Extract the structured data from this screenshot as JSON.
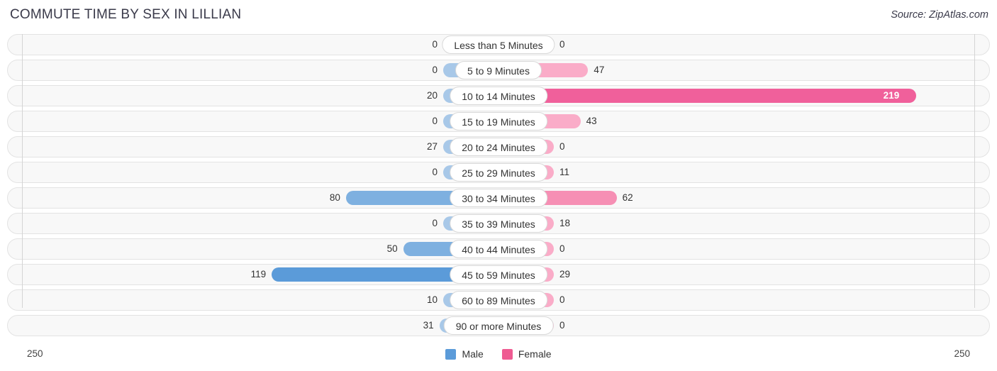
{
  "header": {
    "title": "COMMUTE TIME BY SEX IN LILLIAN",
    "source": "Source: ZipAtlas.com"
  },
  "axis": {
    "left_end": "250",
    "right_end": "250",
    "max": 250
  },
  "legend": {
    "items": [
      {
        "label": "Male",
        "color": "#5b9bd9"
      },
      {
        "label": "Female",
        "color": "#ef5b92"
      }
    ]
  },
  "colors": {
    "male_light": "#a8c8e8",
    "male_mid": "#7eb0e0",
    "male_strong": "#5b9bd9",
    "female_light": "#faacc8",
    "female_mid": "#f68fb4",
    "female_strong": "#f0609b"
  },
  "chart_data": {
    "type": "bar",
    "title": "COMMUTE TIME BY SEX IN LILLIAN",
    "orientation": "horizontal-diverging",
    "xlabel": "",
    "ylabel": "",
    "xlim": [
      250,
      250
    ],
    "grid": false,
    "legend_position": "bottom-center",
    "categories": [
      "Less than 5 Minutes",
      "5 to 9 Minutes",
      "10 to 14 Minutes",
      "15 to 19 Minutes",
      "20 to 24 Minutes",
      "25 to 29 Minutes",
      "30 to 34 Minutes",
      "35 to 39 Minutes",
      "40 to 44 Minutes",
      "45 to 59 Minutes",
      "60 to 89 Minutes",
      "90 or more Minutes"
    ],
    "series": [
      {
        "name": "Male",
        "values": [
          0,
          0,
          20,
          0,
          27,
          0,
          80,
          0,
          50,
          119,
          10,
          31
        ]
      },
      {
        "name": "Female",
        "values": [
          0,
          47,
          219,
          43,
          0,
          11,
          62,
          18,
          0,
          29,
          0,
          0
        ]
      }
    ]
  },
  "rows": [
    {
      "label": "Less than 5 Minutes",
      "male": "0",
      "female": "0"
    },
    {
      "label": "5 to 9 Minutes",
      "male": "0",
      "female": "47"
    },
    {
      "label": "10 to 14 Minutes",
      "male": "20",
      "female": "219"
    },
    {
      "label": "15 to 19 Minutes",
      "male": "0",
      "female": "43"
    },
    {
      "label": "20 to 24 Minutes",
      "male": "27",
      "female": "0"
    },
    {
      "label": "25 to 29 Minutes",
      "male": "0",
      "female": "11"
    },
    {
      "label": "30 to 34 Minutes",
      "male": "80",
      "female": "62"
    },
    {
      "label": "35 to 39 Minutes",
      "male": "0",
      "female": "18"
    },
    {
      "label": "40 to 44 Minutes",
      "male": "50",
      "female": "0"
    },
    {
      "label": "45 to 59 Minutes",
      "male": "119",
      "female": "29"
    },
    {
      "label": "60 to 89 Minutes",
      "male": "10",
      "female": "0"
    },
    {
      "label": "90 or more Minutes",
      "male": "31",
      "female": "0"
    }
  ]
}
